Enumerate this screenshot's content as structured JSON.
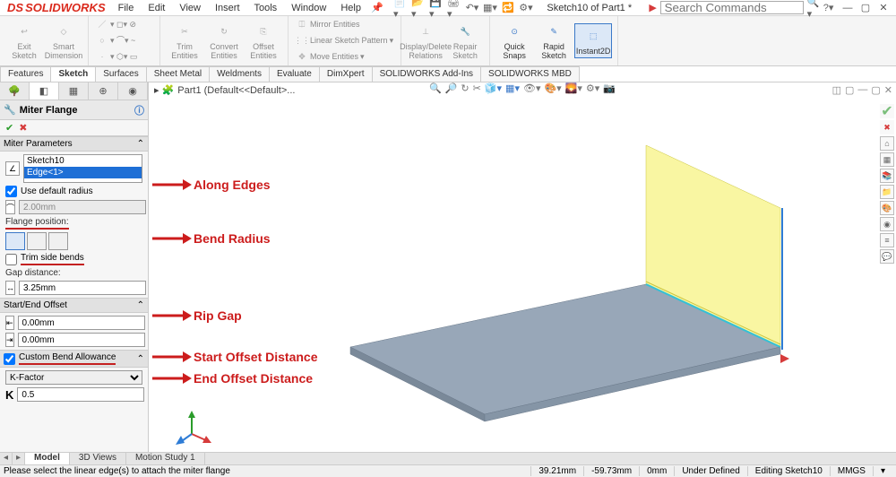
{
  "app": {
    "brand_prefix": "DS",
    "brand": "SOLIDWORKS",
    "doc_title": "Sketch10 of Part1 *",
    "search_placeholder": "Search Commands"
  },
  "menu": [
    "File",
    "Edit",
    "View",
    "Insert",
    "Tools",
    "Window",
    "Help"
  ],
  "ribbon": {
    "exit_sketch": "Exit\nSketch",
    "smart_dim": "Smart\nDimension",
    "trim": "Trim\nEntities",
    "convert": "Convert\nEntities",
    "offset": "Offset\nEntities",
    "mirror": "Mirror Entities",
    "linear": "Linear Sketch Pattern",
    "move": "Move Entities",
    "display": "Display/Delete\nRelations",
    "repair": "Repair\nSketch",
    "quick": "Quick\nSnaps",
    "rapid": "Rapid\nSketch",
    "instant": "Instant2D"
  },
  "feature_tabs": [
    "Features",
    "Sketch",
    "Surfaces",
    "Sheet Metal",
    "Weldments",
    "Evaluate",
    "DimXpert",
    "SOLIDWORKS Add-Ins",
    "SOLIDWORKS MBD"
  ],
  "breadcrumb": "Part1 (Default<<Default>...",
  "feature": {
    "title": "Miter Flange",
    "params_h": "Miter Parameters",
    "list": [
      "Sketch10",
      "Edge<1>"
    ],
    "use_default": "Use default radius",
    "bend_radius": "2.00mm",
    "flange_label": "Flange position:",
    "trim_bends": "Trim side bends",
    "gap_label": "Gap distance:",
    "gap": "3.25mm",
    "offset_h": "Start/End Offset",
    "start": "0.00mm",
    "end": "0.00mm",
    "cba_h": "Custom Bend Allowance",
    "kfactor_label": "K-Factor",
    "kfactor": "0.5"
  },
  "annotations": {
    "along_edges": "Along Edges",
    "bend_radius": "Bend Radius",
    "rip_gap": "Rip Gap",
    "start_offset": "Start Offset Distance",
    "end_offset": "End Offset Distance"
  },
  "view_tabs": [
    "Model",
    "3D Views",
    "Motion Study 1"
  ],
  "status": {
    "hint": "Please select the linear edge(s) to attach the miter flange",
    "x": "39.21mm",
    "y": "-59.73mm",
    "z": "0mm",
    "state": "Under Defined",
    "editing": "Editing Sketch10",
    "units": "MMGS"
  }
}
